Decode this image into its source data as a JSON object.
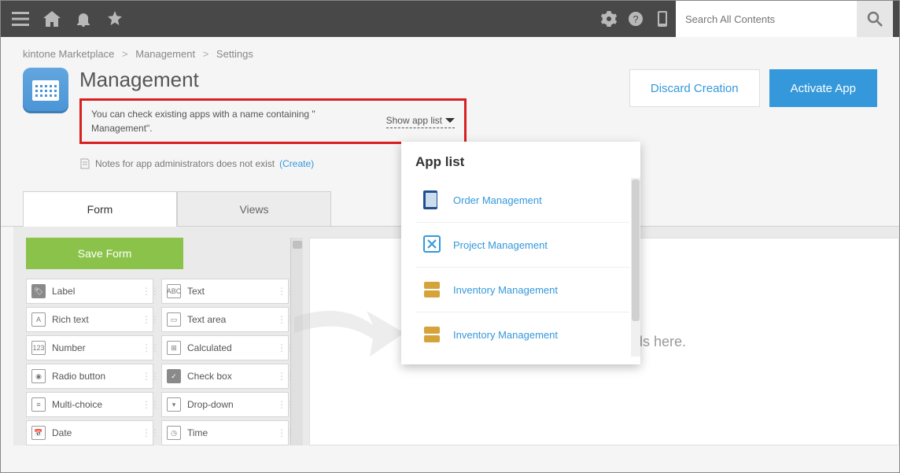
{
  "search": {
    "placeholder": "Search All Contents"
  },
  "breadcrumb": [
    "kintone Marketplace",
    "Management",
    "Settings"
  ],
  "page": {
    "title": "Management",
    "hint_prefix": "You can check existing apps with a name containing \"",
    "hint_term": "Management",
    "hint_suffix": "\".",
    "show_app_list": "Show app list",
    "admin_note": "Notes for app administrators does not exist",
    "admin_note_link": "(Create)",
    "discard": "Discard Creation",
    "activate": "Activate App"
  },
  "tabs": {
    "form": "Form",
    "views": "Views"
  },
  "save_form": "Save Form",
  "canvas_placeholder": "Drag and drop fields here.",
  "fields_left": [
    {
      "label": "Label"
    },
    {
      "label": "Rich text"
    },
    {
      "label": "Number"
    },
    {
      "label": "Radio button"
    },
    {
      "label": "Multi-choice"
    },
    {
      "label": "Date"
    }
  ],
  "fields_right": [
    {
      "label": "Text"
    },
    {
      "label": "Text area"
    },
    {
      "label": "Calculated"
    },
    {
      "label": "Check box"
    },
    {
      "label": "Drop-down"
    },
    {
      "label": "Time"
    }
  ],
  "popover": {
    "title": "App list",
    "items": [
      "Order Management",
      "Project Management",
      "Inventory Management",
      "Inventory Management"
    ]
  }
}
